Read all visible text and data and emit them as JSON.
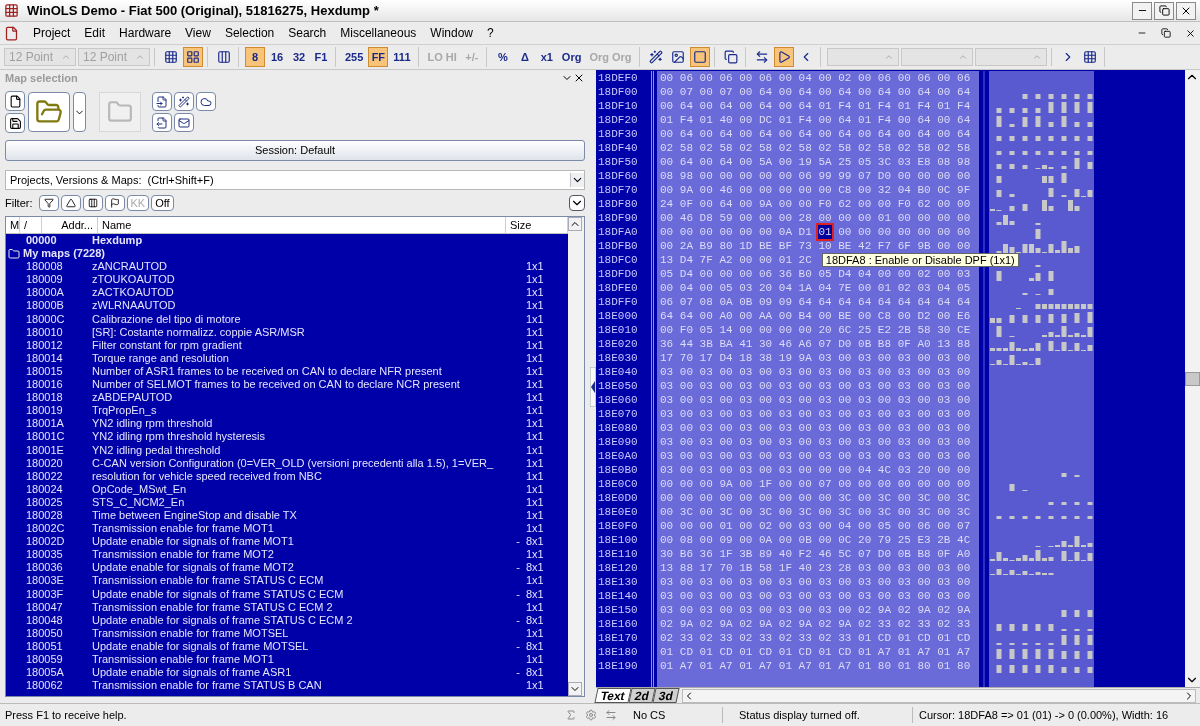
{
  "window": {
    "title": "WinOLS Demo - Fiat 500 (Original), 51816275, Hexdump *"
  },
  "menu": [
    "Project",
    "Edit",
    "Hardware",
    "View",
    "Selection",
    "Search",
    "Miscellaneous",
    "Window",
    "?"
  ],
  "toolbar": {
    "groups": [
      [
        {
          "kind": "field",
          "value": "12 Point",
          "disabled": true
        },
        {
          "kind": "field",
          "value": "12 Point",
          "disabled": true
        }
      ],
      [
        {
          "kind": "icon",
          "selected": false
        },
        {
          "kind": "icon",
          "selected": true
        }
      ],
      [
        {
          "kind": "icon",
          "selected": false
        }
      ],
      [
        {
          "kind": "text",
          "label": "8",
          "selected": true,
          "disabled": false
        },
        {
          "kind": "text",
          "label": "16",
          "selected": false,
          "disabled": false
        },
        {
          "kind": "text",
          "label": "32",
          "selected": false,
          "disabled": false
        },
        {
          "kind": "text",
          "label": "F1",
          "selected": false,
          "disabled": false
        }
      ],
      [
        {
          "kind": "text",
          "label": "255",
          "selected": false,
          "disabled": false
        },
        {
          "kind": "text",
          "label": "FF",
          "selected": true,
          "disabled": false
        },
        {
          "kind": "text",
          "label": "111",
          "selected": false,
          "disabled": false
        }
      ],
      [
        {
          "kind": "text",
          "label": "LO HI",
          "selected": false,
          "disabled": true
        },
        {
          "kind": "text",
          "label": "+/-",
          "selected": false,
          "disabled": true
        }
      ],
      [
        {
          "kind": "text",
          "label": "%",
          "selected": false,
          "disabled": false
        },
        {
          "kind": "text",
          "label": "Δ",
          "selected": false,
          "disabled": false
        },
        {
          "kind": "text",
          "label": "x1",
          "selected": false,
          "disabled": false
        },
        {
          "kind": "text",
          "label": "Org",
          "selected": false,
          "disabled": false
        },
        {
          "kind": "text",
          "label": "Org Org",
          "selected": false,
          "disabled": true
        }
      ],
      [
        {
          "kind": "icon",
          "selected": false
        },
        {
          "kind": "icon",
          "selected": false
        },
        {
          "kind": "icon",
          "selected": true
        }
      ],
      [
        {
          "kind": "icon",
          "selected": false
        }
      ],
      [
        {
          "kind": "icon",
          "selected": false
        },
        {
          "kind": "icon",
          "selected": true
        },
        {
          "kind": "icon",
          "selected": false
        }
      ],
      [
        {
          "kind": "field",
          "disabled": true
        },
        {
          "kind": "field",
          "disabled": true
        },
        {
          "kind": "field",
          "disabled": true
        }
      ],
      [
        {
          "kind": "icon",
          "selected": false
        },
        {
          "kind": "icon",
          "selected": false
        }
      ]
    ]
  },
  "map_selection": {
    "title": "Map selection",
    "session": "Session: Default",
    "search": {
      "value": "Projects, Versions & Maps:  (Ctrl+Shift+F)"
    },
    "filter": {
      "label": "Filter:",
      "buttons": [
        {
          "kind": "icon",
          "disabled": false
        },
        {
          "kind": "icon",
          "disabled": false
        },
        {
          "kind": "icon",
          "disabled": false
        },
        {
          "kind": "icon",
          "disabled": false
        },
        {
          "kind": "text",
          "label": "KK",
          "disabled": true
        },
        {
          "kind": "text",
          "label": "Off",
          "disabled": false
        }
      ]
    },
    "table": {
      "columns": [
        "M",
        "/",
        "Addr...",
        "Name",
        "Size"
      ],
      "rows": [
        {
          "kind": "file",
          "address": "00000",
          "name": "Hexdump"
        },
        {
          "kind": "folder",
          "name": "My maps (7228)"
        },
        {
          "kind": "map",
          "address": "180008",
          "name": "zANCRAUTOD",
          "size": "1x1"
        },
        {
          "kind": "map",
          "address": "180009",
          "name": "zTOUKOAUTOD",
          "size": "1x1"
        },
        {
          "kind": "map",
          "address": "18000A",
          "name": "zACTKOAUTOD",
          "size": "1x1"
        },
        {
          "kind": "map",
          "address": "18000B",
          "name": "zWLRNAAUTOD",
          "size": "1x1"
        },
        {
          "kind": "map",
          "address": "18000C",
          "name": "Calibrazione del tipo di motore",
          "size": "1x1"
        },
        {
          "kind": "map",
          "address": "180010",
          "name": "[SR]: Costante normalizz. coppie ASR/MSR",
          "size": "1x1"
        },
        {
          "kind": "map",
          "address": "180012",
          "name": "Filter constant for rpm gradient",
          "size": "1x1"
        },
        {
          "kind": "map",
          "address": "180014",
          "name": "Torque range and resolution",
          "size": "1x1"
        },
        {
          "kind": "map",
          "address": "180015",
          "name": "Number of ASR1 frames to be received on CAN to declare NFR present",
          "size": "1x1"
        },
        {
          "kind": "map",
          "address": "180016",
          "name": "Number of SELMOT frames to be received on CAN to declare NCR present",
          "size": "1x1"
        },
        {
          "kind": "map",
          "address": "180018",
          "name": "zABDEPAUTOD",
          "size": "1x1"
        },
        {
          "kind": "map",
          "address": "180019",
          "name": "TrqPropEn_s",
          "size": "1x1"
        },
        {
          "kind": "map",
          "address": "18001A",
          "name": "YN2 idling rpm threshold",
          "size": "1x1"
        },
        {
          "kind": "map",
          "address": "18001C",
          "name": "YN2 idling rpm threshold hysteresis",
          "size": "1x1"
        },
        {
          "kind": "map",
          "address": "18001E",
          "name": "YN2 idling pedal threshold",
          "size": "1x1"
        },
        {
          "kind": "map",
          "address": "180020",
          "name": "C-CAN version Configuration (0=VER_OLD (versioni precedenti alla 1.5), 1=VER_",
          "size": "1x1"
        },
        {
          "kind": "map",
          "address": "180022",
          "name": "resolution for vehicle speed received from NBC",
          "size": "1x1"
        },
        {
          "kind": "map",
          "address": "180024",
          "name": "OpCode_MSwt_En",
          "size": "1x1"
        },
        {
          "kind": "map",
          "address": "180025",
          "name": "STS_C_NCM2_En",
          "size": "1x1"
        },
        {
          "kind": "map",
          "address": "180028",
          "name": "Time between EngineStop and disable TX",
          "size": "1x1"
        },
        {
          "kind": "map",
          "address": "18002C",
          "name": "Transmission enable for frame MOT1",
          "size": "1x1"
        },
        {
          "kind": "map",
          "address": "18002D",
          "name": "Update enable for signals of frame MOT1",
          "flag": "-",
          "size": "8x1"
        },
        {
          "kind": "map",
          "address": "180035",
          "name": "Transmission enable for frame MOT2",
          "size": "1x1"
        },
        {
          "kind": "map",
          "address": "180036",
          "name": "Update enable for signals of frame MOT2",
          "flag": "-",
          "size": "8x1"
        },
        {
          "kind": "map",
          "address": "18003E",
          "name": "Transmission enable for frame STATUS C ECM",
          "size": "1x1"
        },
        {
          "kind": "map",
          "address": "18003F",
          "name": "Update enable for signals of frame STATUS C ECM",
          "flag": "-",
          "size": "8x1"
        },
        {
          "kind": "map",
          "address": "180047",
          "name": "Transmission enable for frame STATUS C ECM 2",
          "size": "1x1"
        },
        {
          "kind": "map",
          "address": "180048",
          "name": "Update enable for signals of frame STATUS C ECM 2",
          "flag": "-",
          "size": "8x1"
        },
        {
          "kind": "map",
          "address": "180050",
          "name": "Transmission enable for frame MOTSEL",
          "size": "1x1"
        },
        {
          "kind": "map",
          "address": "180051",
          "name": "Update enable for signals of frame MOTSEL",
          "flag": "-",
          "size": "8x1"
        },
        {
          "kind": "map",
          "address": "180059",
          "name": "Transmission enable for frame MOT1",
          "size": "1x1"
        },
        {
          "kind": "map",
          "address": "18005A",
          "name": "Update enable for signals of frame ASR1",
          "flag": "-",
          "size": "8x1"
        },
        {
          "kind": "map",
          "address": "180062",
          "name": "Transmission enable for frame STATUS B CAN",
          "size": "1x1"
        }
      ]
    }
  },
  "hexdump": {
    "rows": [
      {
        "address": "18DEF0",
        "bytes": "00 06 00 06 00 06 00 04 00 02 00 06 00 06 00 06"
      },
      {
        "address": "18DF00",
        "bytes": "00 07 00 07 00 64 00 64 00 64 00 64 00 64 00 64"
      },
      {
        "address": "18DF10",
        "bytes": "00 64 00 64 00 64 00 64 01 F4 01 F4 01 F4 01 F4"
      },
      {
        "address": "18DF20",
        "bytes": "01 F4 01 40 00 DC 01 F4 00 64 01 F4 00 64 00 64"
      },
      {
        "address": "18DF30",
        "bytes": "00 64 00 64 00 64 00 64 00 64 00 64 00 64 00 64"
      },
      {
        "address": "18DF40",
        "bytes": "02 58 02 58 02 58 02 58 02 58 02 58 02 58 02 58"
      },
      {
        "address": "18DF50",
        "bytes": "00 64 00 64 00 5A 00 19 5A 25 05 3C 03 E8 08 98"
      },
      {
        "address": "18DF60",
        "bytes": "08 98 00 00 00 00 00 06 99 99 07 D0 00 00 00 00"
      },
      {
        "address": "18DF70",
        "bytes": "00 9A 00 46 00 00 00 00 00 C8 00 32 04 B0 0C 9F"
      },
      {
        "address": "18DF80",
        "bytes": "24 0F 00 64 00 9A 00 00 F0 62 00 00 F0 62 00 00"
      },
      {
        "address": "18DF90",
        "bytes": "00 46 D8 59 00 00 00 28 00 00 00 01 00 00 00 00"
      },
      {
        "address": "18DFA0",
        "bytes": "00 00 00 00 00 00 0A D1",
        "cursor": "01",
        "bytes_after": "00 00 00 00 00 00 00"
      },
      {
        "address": "18DFB0",
        "bytes": "00 2A B9 80 1D BE BF 73 10 BE 42 F7 6F 9B 00 00"
      },
      {
        "address": "18DFC0",
        "bytes": "13 D4 7F A2 00 00 01 2C",
        "tooltip": "18DFA8 : Enable or Disable DPF (1x1)"
      },
      {
        "address": "18DFD0",
        "bytes": "05 D4 00 00 00 06 36 B0 05 D4 04 00 00 02 00 03"
      },
      {
        "address": "18DFE0",
        "bytes": "00 04 00 05 03 20 04 1A 04 7E 00 01 02 03 04 05"
      },
      {
        "address": "18DFF0",
        "bytes": "06 07 08 0A 0B 09 09 64 64 64 64 64 64 64 64 64"
      },
      {
        "address": "18E000",
        "bytes": "64 64 00 A0 00 AA 00 B4 00 BE 00 C8 00 D2 00 E6"
      },
      {
        "address": "18E010",
        "bytes": "00 F0 05 14 00 00 00 00 20 6C 25 E2 2B 58 30 CE"
      },
      {
        "address": "18E020",
        "bytes": "36 44 3B BA 41 30 46 A6 07 D0 0B B8 0F A0 13 88"
      },
      {
        "address": "18E030",
        "bytes": "17 70 17 D4 18 38 19 9A 03 00 03 00 03 00 03 00"
      },
      {
        "address": "18E040",
        "bytes": "03 00 03 00 03 00 03 00 03 00 03 00 03 00 03 00"
      },
      {
        "address": "18E050",
        "bytes": "03 00 03 00 03 00 03 00 03 00 03 00 03 00 03 00"
      },
      {
        "address": "18E060",
        "bytes": "03 00 03 00 03 00 03 00 03 00 03 00 03 00 03 00"
      },
      {
        "address": "18E070",
        "bytes": "03 00 03 00 03 00 03 00 03 00 03 00 03 00 03 00"
      },
      {
        "address": "18E080",
        "bytes": "03 00 03 00 03 00 03 00 03 00 03 00 03 00 03 00"
      },
      {
        "address": "18E090",
        "bytes": "03 00 03 00 03 00 03 00 03 00 03 00 03 00 03 00"
      },
      {
        "address": "18E0A0",
        "bytes": "03 00 03 00 03 00 03 00 03 00 03 00 03 00 03 00"
      },
      {
        "address": "18E0B0",
        "bytes": "03 00 03 00 03 00 03 00 00 00 04 4C 03 20 00 00"
      },
      {
        "address": "18E0C0",
        "bytes": "00 00 00 9A 00 1F 00 00 07 00 00 00 00 00 00 00"
      },
      {
        "address": "18E0D0",
        "bytes": "00 00 00 00 00 00 00 00 00 3C 00 3C 00 3C 00 3C"
      },
      {
        "address": "18E0E0",
        "bytes": "00 3C 00 3C 00 3C 00 3C 00 3C 00 3C 00 3C 00 3C"
      },
      {
        "address": "18E0F0",
        "bytes": "00 00 00 01 00 02 00 03 00 04 00 05 00 06 00 07"
      },
      {
        "address": "18E100",
        "bytes": "00 08 00 09 00 0A 00 0B 00 0C 20 79 25 E3 2B 4C"
      },
      {
        "address": "18E110",
        "bytes": "30 B6 36 1F 3B 89 40 F2 46 5C 07 D0 0B B8 0F A0"
      },
      {
        "address": "18E120",
        "bytes": "13 88 17 70 1B 58 1F 40 23 28 03 00 03 00 03 00"
      },
      {
        "address": "18E130",
        "bytes": "03 00 03 00 03 00 03 00 03 00 03 00 03 00 03 00"
      },
      {
        "address": "18E140",
        "bytes": "03 00 03 00 03 00 03 00 03 00 03 00 03 00 03 00"
      },
      {
        "address": "18E150",
        "bytes": "03 00 03 00 03 00 03 00 03 00 02 9A 02 9A 02 9A"
      },
      {
        "address": "18E160",
        "bytes": "02 9A 02 9A 02 9A 02 9A 02 9A 02 33 02 33 02 33"
      },
      {
        "address": "18E170",
        "bytes": "02 33 02 33 02 33 02 33 02 33 01 CD 01 CD 01 CD"
      },
      {
        "address": "18E180",
        "bytes": "01 CD 01 CD 01 CD 01 CD 01 CD 01 A7 01 A7 01 A7"
      },
      {
        "address": "18E190",
        "bytes": "01 A7 01 A7 01 A7 01 A7 01 A7 01 80 01 80 01 80"
      }
    ],
    "tabs": [
      {
        "label": "Text",
        "selected": true
      },
      {
        "label": "2d",
        "selected": false
      },
      {
        "label": "3d",
        "selected": false
      }
    ]
  },
  "status_bar": {
    "help": "Press F1 to receive help.",
    "checksum": "No CS",
    "status": "Status display turned off.",
    "cursor": "Cursor: 18DFA8 => 01 (01) -> 0 (0.00%), Width: 16"
  }
}
